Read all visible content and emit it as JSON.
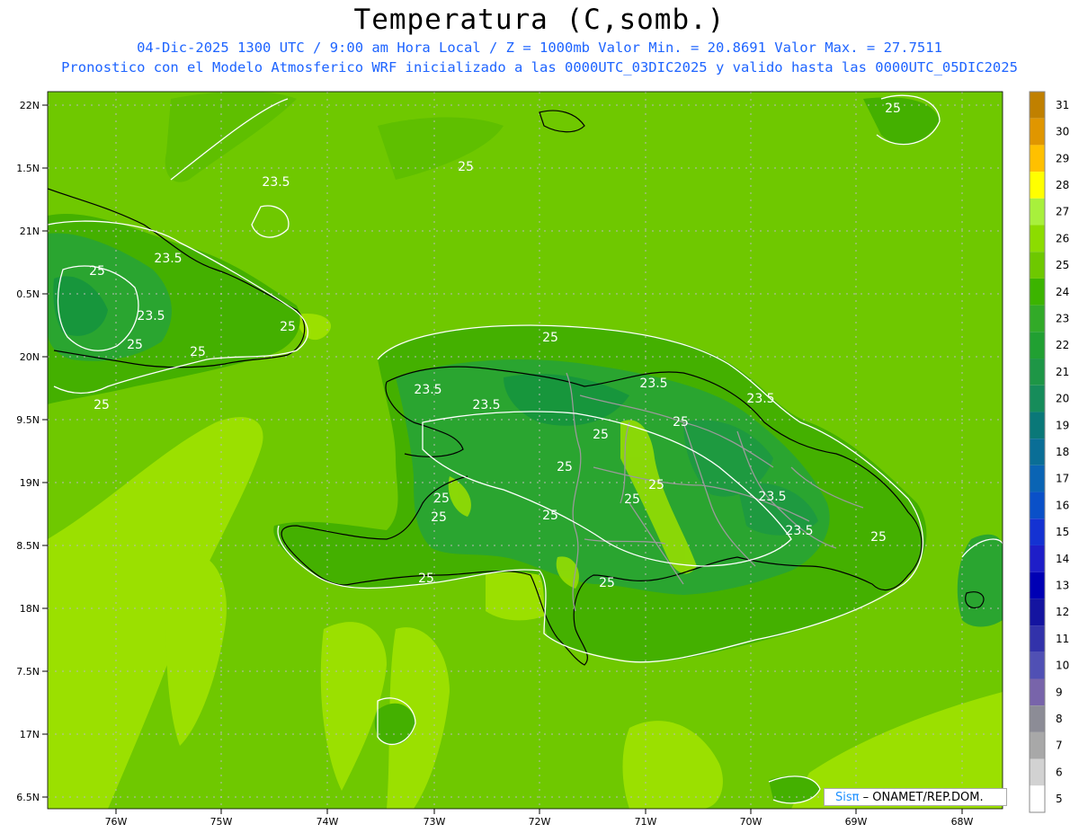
{
  "header": {
    "title": "Temperatura (C,somb.)",
    "subtitle_line1": "04-Dic-2025  1300 UTC / 9:00 am Hora Local / Z = 1000mb   Valor Min. = 20.8691  Valor Max. = 27.7511",
    "subtitle_line2": "Pronostico con el Modelo Atmosferico WRF inicializado a las 0000UTC_03DIC2025 y valido hasta las  0000UTC_05DIC2025"
  },
  "map": {
    "lat_labels": [
      "22N",
      "1.5N",
      "21N",
      "0.5N",
      "20N",
      "9.5N",
      "19N",
      "8.5N",
      "18N",
      "7.5N",
      "17N",
      "6.5N"
    ],
    "lon_labels": [
      "76W",
      "75W",
      "74W",
      "73W",
      "72W",
      "71W",
      "70W",
      "69W",
      "68W"
    ],
    "contour_labels": [
      "25",
      "25",
      "23.5",
      "25",
      "23.5",
      "23.5",
      "25",
      "25",
      "25",
      "25",
      "25",
      "23.5",
      "23.5",
      "23.5",
      "23.5",
      "25",
      "25",
      "25",
      "25",
      "23.5",
      "23.5",
      "25",
      "25",
      "25",
      "25",
      "25",
      "25",
      "25"
    ],
    "colors": {
      "sea_light": "#9be000",
      "sea": "#6fc800",
      "land": "#44b000",
      "land_dark": "#21a032",
      "land_darkest": "#17963c",
      "coast": "#000000",
      "border": "#999999",
      "contour": "#ffffff"
    }
  },
  "colorbar": {
    "labels": [
      "31",
      "30",
      "29",
      "28",
      "27",
      "26",
      "25",
      "24",
      "23",
      "22",
      "21",
      "20",
      "19",
      "18",
      "17",
      "16",
      "15",
      "14",
      "13",
      "12",
      "11",
      "10",
      "9",
      "8",
      "7",
      "6",
      "5"
    ],
    "colors": [
      "#c08000",
      "#e09600",
      "#ffc000",
      "#ffff00",
      "#a8f03c",
      "#8cdc00",
      "#6ec800",
      "#3cb400",
      "#32aa28",
      "#21a032",
      "#1e9646",
      "#168c5a",
      "#0a7878",
      "#0a6e96",
      "#0a64b4",
      "#0a50c8",
      "#1432d2",
      "#1e1ec8",
      "#0000b4",
      "#1414a0",
      "#3232aa",
      "#5050b4",
      "#7864aa",
      "#8c8c96",
      "#a8a8a8",
      "#d2d2d2",
      "#ffffff"
    ]
  },
  "credit": {
    "logo": "Sisπ",
    "text": " – ONAMET/REP.DOM."
  }
}
